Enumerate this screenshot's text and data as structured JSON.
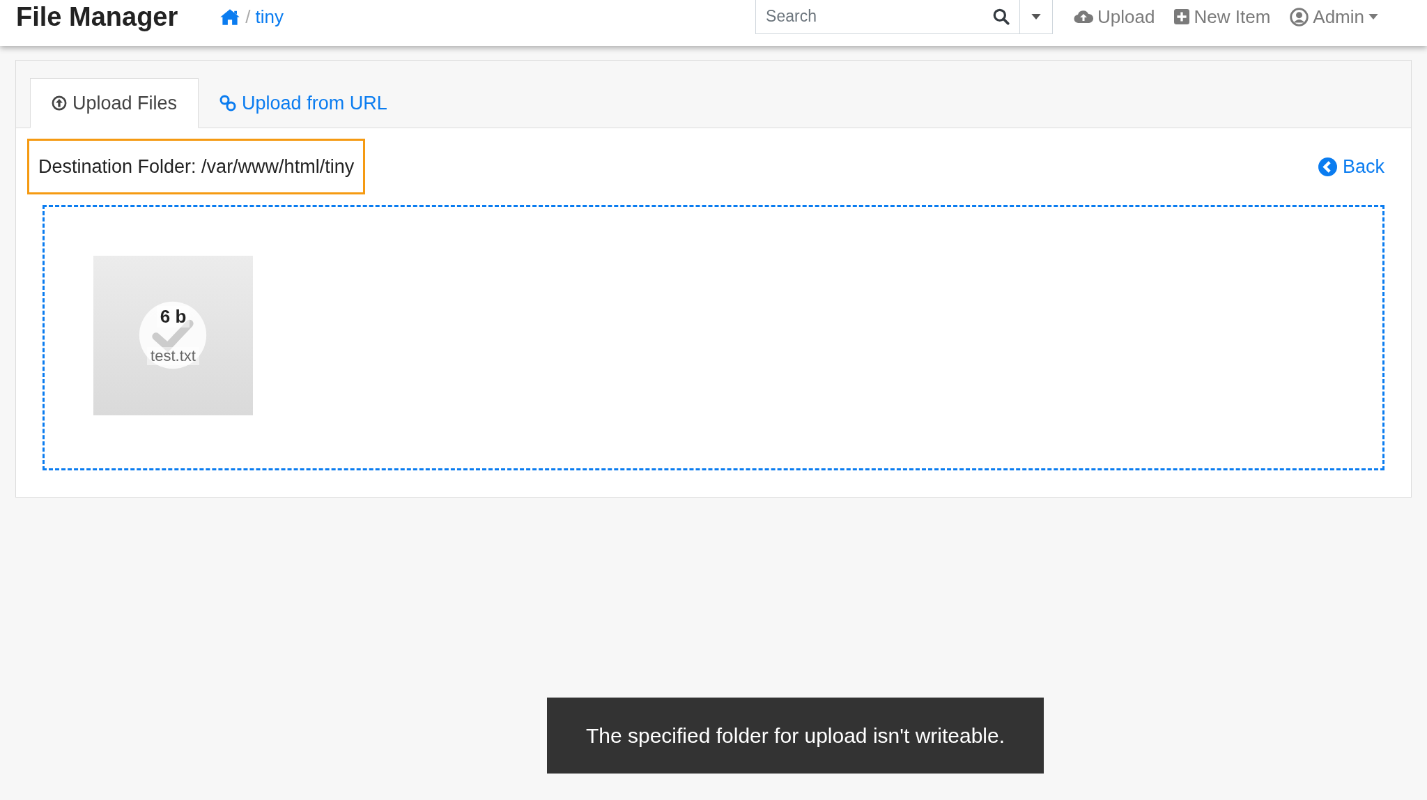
{
  "header": {
    "title": "File Manager",
    "breadcrumb": {
      "separator": "/",
      "folder": "tiny"
    },
    "search": {
      "placeholder": "Search"
    },
    "nav": [
      {
        "kind": "upload",
        "label": "Upload"
      },
      {
        "kind": "new",
        "label": "New Item"
      },
      {
        "kind": "user",
        "label": "Admin"
      }
    ]
  },
  "tabs": [
    {
      "kind": "files",
      "label": "Upload Files",
      "selected": true
    },
    {
      "kind": "url",
      "label": "Upload from URL",
      "selected": false
    }
  ],
  "destination": "Destination Folder: /var/www/html/tiny",
  "back": "Back",
  "files": [
    {
      "size": "6 b",
      "name": "test.txt",
      "done": true
    }
  ],
  "toast": "The specified folder for upload isn't writeable."
}
